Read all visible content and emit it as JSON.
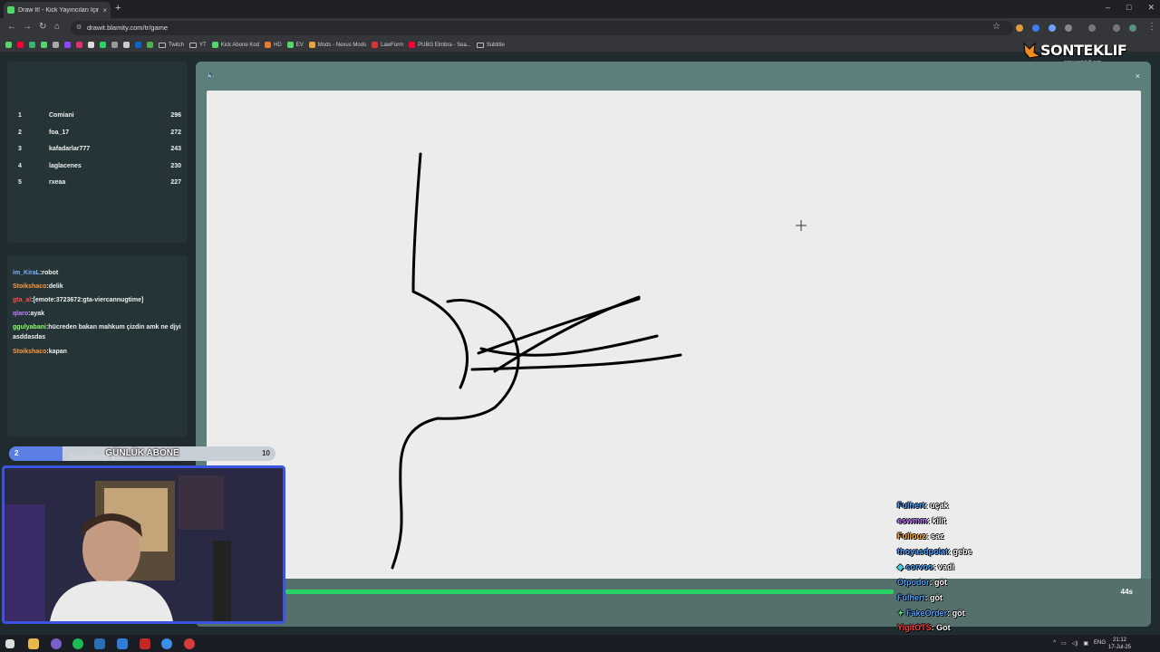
{
  "browser": {
    "tab_title": "Draw It! - Kick Yayıncıları İçin Çiz",
    "tab_close": "×",
    "new_tab": "+",
    "url": "drawit.blamity.com/tr/game",
    "window_controls": [
      "–",
      "□",
      "✕"
    ],
    "bookmarks": [
      {
        "label": "Twitch",
        "type": "folder"
      },
      {
        "label": "YT",
        "type": "folder"
      },
      {
        "label": "Kick Abone Kod",
        "type": "link"
      },
      {
        "label": "HD",
        "type": "link"
      },
      {
        "label": "EV",
        "type": "folder"
      },
      {
        "label": "Mods - Nexus Mods",
        "type": "link"
      },
      {
        "label": "LawForm",
        "type": "link"
      },
      {
        "label": "PUBG Elmbra - Sea...",
        "type": "link"
      },
      {
        "label": "Subtitle",
        "type": "folder"
      }
    ]
  },
  "logo": {
    "name": "SONTEKLIF",
    "url": "www.sonteklif.com"
  },
  "leaderboard": [
    {
      "rank": "1",
      "name": "Comiani",
      "score": "296"
    },
    {
      "rank": "2",
      "name": "foa_17",
      "score": "272"
    },
    {
      "rank": "3",
      "name": "kafadarlar777",
      "score": "243"
    },
    {
      "rank": "4",
      "name": "laglacenes",
      "score": "230"
    },
    {
      "rank": "5",
      "name": "rxeaa",
      "score": "227"
    }
  ],
  "chat": [
    {
      "user": "im_KiraL",
      "msg": ":robot",
      "color": "#7fb0ff"
    },
    {
      "user": "Stoikshaco",
      "msg": ":delik",
      "color": "#ff9a3c"
    },
    {
      "user": "gta_al",
      "msg": ":[emote:3723672:gta-viercannugtime]",
      "color": "#ff4d4d"
    },
    {
      "user": "qlaro",
      "msg": ":ayak",
      "color": "#c77dff"
    },
    {
      "user": "ggulyabani",
      "msg": ":hücreden bakan mahkum çizdin amk ne djyi asddasdas",
      "color": "#8cff6b"
    },
    {
      "user": "Stoikshaco",
      "msg": ":kapan",
      "color": "#ff9a3c"
    }
  ],
  "subscription": {
    "title": "GÜNLÜK ABONE",
    "current": "2",
    "goal": "10",
    "progress": 0.2,
    "hint": "Şu kelimeyi ya..."
  },
  "game": {
    "time_left": "44s",
    "timer_fraction": 0.74,
    "speaker_icon": "🔈",
    "close_icon": "×",
    "cursor": "+"
  },
  "guesses": [
    {
      "user": "Fulhert",
      "word": ": uçak",
      "color": "#4da3ff"
    },
    {
      "user": "eswmm",
      "word": ": kilit",
      "color": "#c77dff"
    },
    {
      "user": "Fullouz",
      "word": ": saz",
      "color": "#ffb43c"
    },
    {
      "user": "thoyasdpolat",
      "word": ": gebe",
      "color": "#4da3ff"
    },
    {
      "user": "corvoo",
      "word": ": vadi",
      "color": "#4da3ff"
    },
    {
      "user": "Otpodor",
      "word": ": göt",
      "color": "#4da3ff"
    },
    {
      "user": "Fulhert",
      "word": ": göt",
      "color": "#4da3ff"
    },
    {
      "user": "FakeOrder",
      "word": ": göt",
      "color": "#4da3ff"
    },
    {
      "user": "YigitOTS",
      "word": ": Göt",
      "color": "#ff3b3b"
    }
  ],
  "taskbar": {
    "lang": "ENG",
    "time": "21:12",
    "date": "17-Jul-25"
  }
}
